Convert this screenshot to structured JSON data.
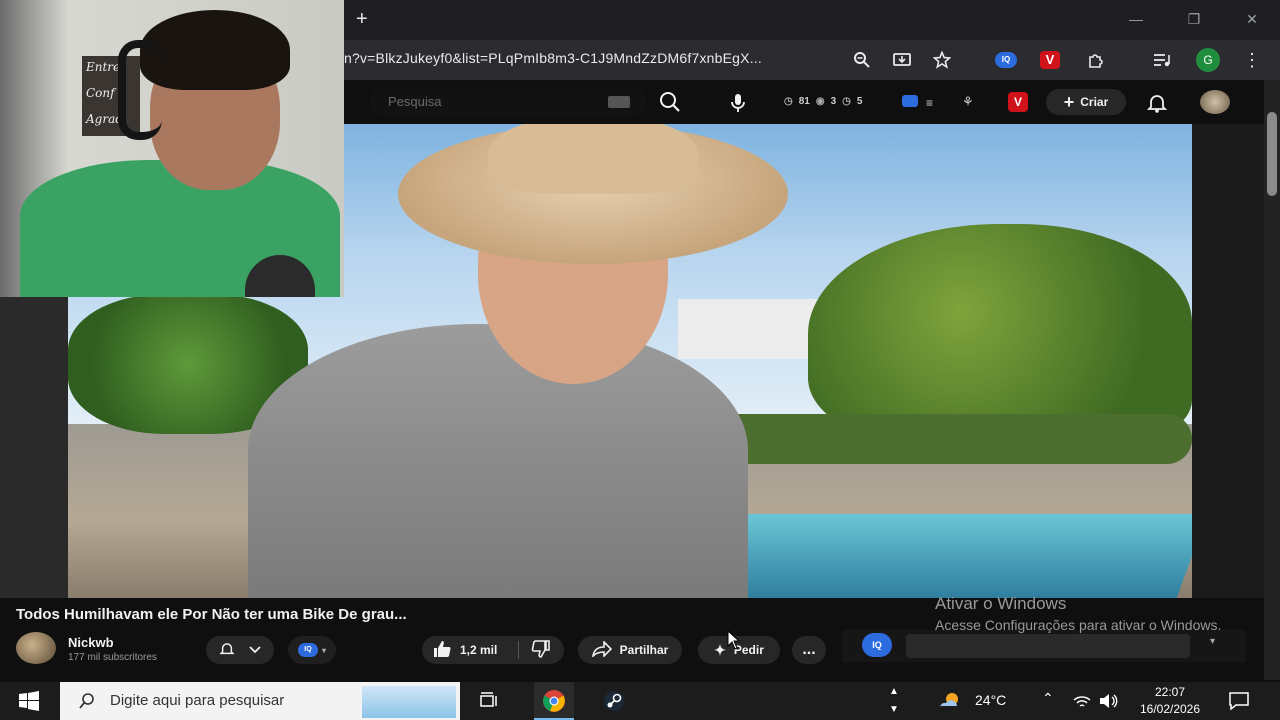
{
  "browser": {
    "new_tab_symbol": "+",
    "url": "n?v=BlkzJukeyf0&list=PLqPmIb8m3-C1J9MndZzDM6f7xnbEgX...",
    "profile_initial": "G",
    "ext_v_label": "V",
    "ext_iq_label": "IQ"
  },
  "youtube_header": {
    "search_placeholder": "Pesquisa",
    "stat1": "81",
    "stat2": "3",
    "stat3": "5",
    "create_label": "Criar"
  },
  "webcam_sign": [
    "Entre",
    "Conf",
    "Agrad"
  ],
  "video": {
    "title": "Todos Humilhavam ele Por Não ter uma Bike De grau...",
    "channel_name": "Nickwb",
    "subscribers": "177 mil subscritores",
    "likes": "1,2 mil",
    "share_label": "Partilhar",
    "ask_label": "Pedir",
    "more_label": "..."
  },
  "windows_activation": {
    "title": "Ativar o Windows",
    "body": "Acesse Configurações para ativar o Windows."
  },
  "taskbar": {
    "search_placeholder": "Digite aqui para pesquisar",
    "temperature": "24°C",
    "time": "22:07",
    "date": "16/02/2026"
  },
  "colors": {
    "iq_blue": "#2d6cdf",
    "v_red": "#d0121b",
    "profile_green": "#1e8e3e"
  }
}
